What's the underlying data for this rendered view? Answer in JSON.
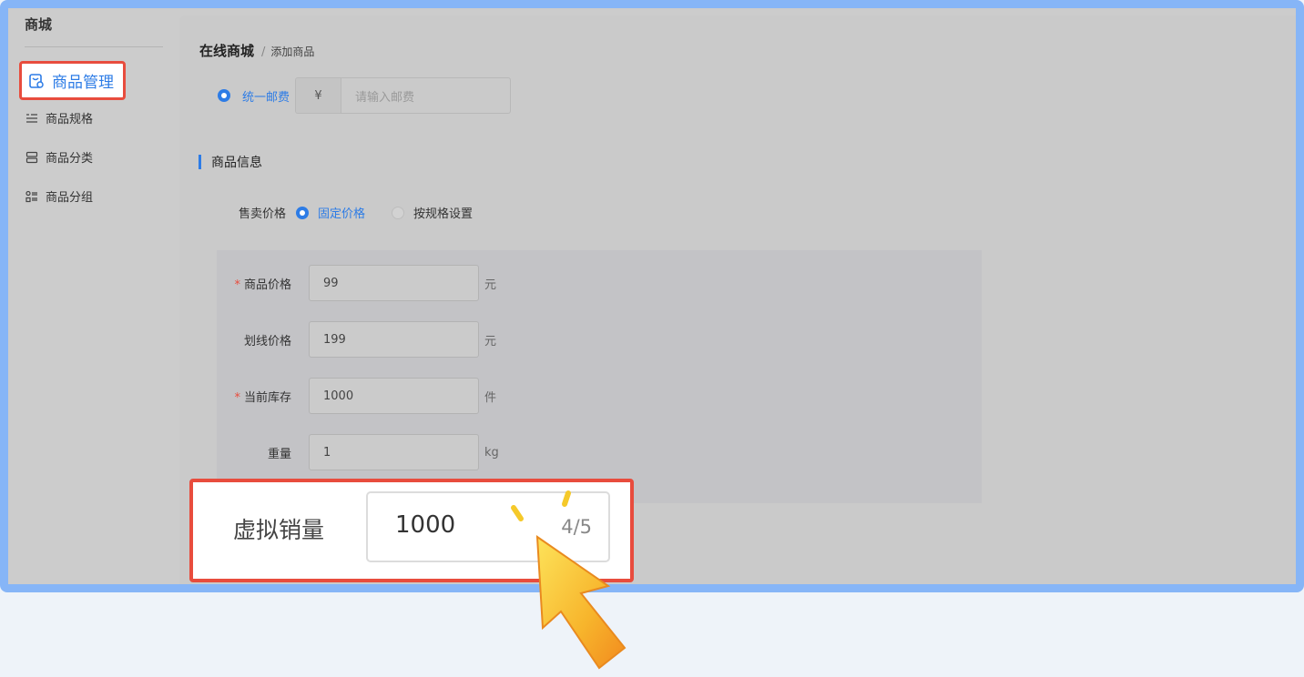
{
  "sidebar": {
    "title": "商城",
    "items": [
      {
        "label": "商品管理",
        "icon": "bag-icon",
        "active": true
      },
      {
        "label": "商品规格",
        "icon": "spec-list-icon"
      },
      {
        "label": "商品分类",
        "icon": "category-icon"
      },
      {
        "label": "商品分组",
        "icon": "group-icon"
      }
    ]
  },
  "breadcrumb": {
    "root": "在线商城",
    "separator": "/",
    "current": "添加商品"
  },
  "shipping": {
    "option_label": "统一邮费",
    "prefix": "¥",
    "placeholder": "请输入邮费"
  },
  "section": {
    "title": "商品信息"
  },
  "sale_price": {
    "label": "售卖价格",
    "option_fixed": "固定价格",
    "option_spec": "按规格设置",
    "selected": "固定价格"
  },
  "fields": [
    {
      "label": "商品价格",
      "required": true,
      "value": "99",
      "unit": "元"
    },
    {
      "label": "划线价格",
      "required": false,
      "value": "199",
      "unit": "元"
    },
    {
      "label": "当前库存",
      "required": true,
      "value": "1000",
      "unit": "件"
    },
    {
      "label": "重量",
      "required": false,
      "value": "1",
      "unit": "kg"
    }
  ],
  "virtual_sales": {
    "label": "虚拟销量",
    "value": "1000",
    "counter": "4/5"
  },
  "colors": {
    "accent": "#2d7ce6",
    "highlight_border": "#e84c3d",
    "frame": "#86b5f7"
  }
}
